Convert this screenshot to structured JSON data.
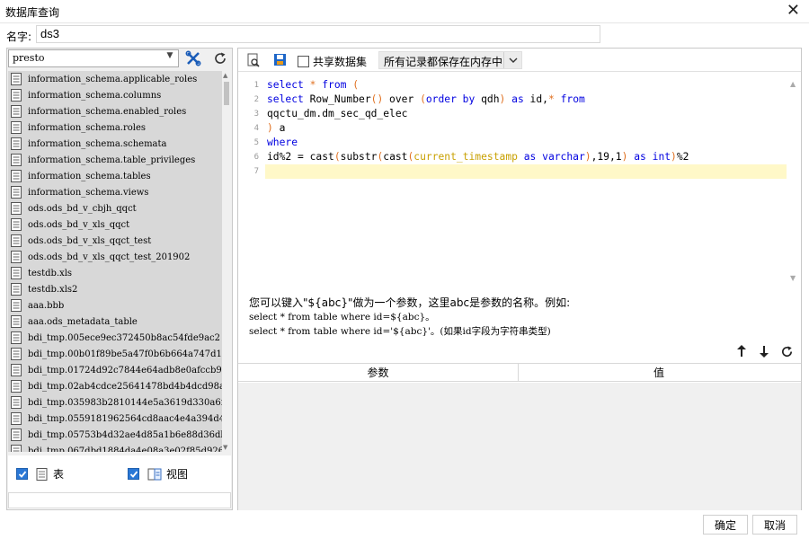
{
  "window": {
    "title": "数据库查询",
    "close_glyph": "✕"
  },
  "name_field": {
    "label": "名字:",
    "value": "ds3"
  },
  "left_panel": {
    "connection": "presto",
    "tables": [
      "information_schema.applicable_roles",
      "information_schema.columns",
      "information_schema.enabled_roles",
      "information_schema.roles",
      "information_schema.schemata",
      "information_schema.table_privileges",
      "information_schema.tables",
      "information_schema.views",
      "ods.ods_bd_v_cbjh_qqct",
      "ods.ods_bd_v_xls_qqct",
      "ods.ods_bd_v_xls_qqct_test",
      "ods.ods_bd_v_xls_qqct_test_201902",
      "testdb.xls",
      "testdb.xls2",
      "aaa.bbb",
      "aaa.ods_metadata_table",
      "bdi_tmp.005ece9ec372450b8ac54fde9ac2",
      "bdi_tmp.00b01f89be5a47f0b6b664a747d1",
      "bdi_tmp.01724d92c7844e64adb8e0afccb9",
      "bdi_tmp.02ab4cdce25641478bd4b4dcd98a",
      "bdi_tmp.035983b2810144e5a3619d330a6f",
      "bdi_tmp.0559181962564cd8aac4e4a394d4",
      "bdi_tmp.05753b4d32ae4d85a1b6e88d36db",
      "bdi_tmp.067dbd1884da4e08a3e02f85d926"
    ],
    "check_tables_label": "表",
    "check_views_label": "视图"
  },
  "toolbar": {
    "share_label": "共享数据集",
    "mode_value": "所有记录都保存在内存中"
  },
  "editor": {
    "line_numbers": [
      "1",
      "2",
      "3",
      "4",
      "5",
      "6",
      "7"
    ]
  },
  "hint": {
    "line1": "您可以键入\"${abc}\"做为一个参数，这里abc是参数的名称。例如:",
    "line2": "select * from table where id=${abc}。",
    "line3": "select * from table where id='${abc}'。(如果id字段为字符串类型)"
  },
  "params_table": {
    "col_param": "参数",
    "col_value": "值"
  },
  "buttons": {
    "ok": "确定",
    "cancel": "取消"
  }
}
